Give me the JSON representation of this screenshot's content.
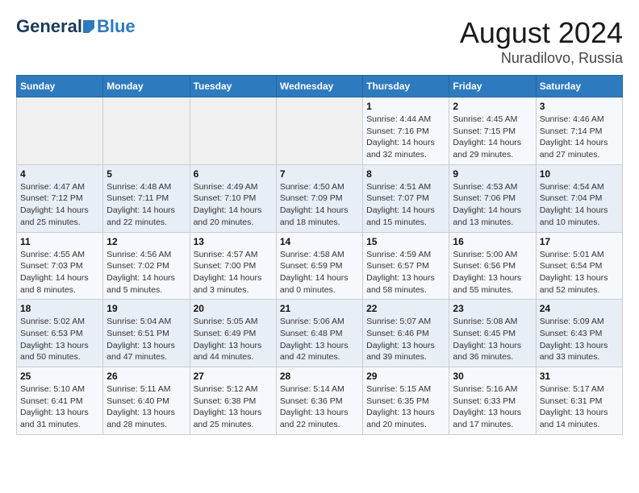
{
  "header": {
    "logo_general": "General",
    "logo_blue": "Blue",
    "month": "August 2024",
    "location": "Nuradilovo, Russia"
  },
  "weekdays": [
    "Sunday",
    "Monday",
    "Tuesday",
    "Wednesday",
    "Thursday",
    "Friday",
    "Saturday"
  ],
  "weeks": [
    [
      {
        "day": "",
        "info": ""
      },
      {
        "day": "",
        "info": ""
      },
      {
        "day": "",
        "info": ""
      },
      {
        "day": "",
        "info": ""
      },
      {
        "day": "1",
        "sunrise": "4:44 AM",
        "sunset": "7:16 PM",
        "daylight": "14 hours and 32 minutes."
      },
      {
        "day": "2",
        "sunrise": "4:45 AM",
        "sunset": "7:15 PM",
        "daylight": "14 hours and 29 minutes."
      },
      {
        "day": "3",
        "sunrise": "4:46 AM",
        "sunset": "7:14 PM",
        "daylight": "14 hours and 27 minutes."
      }
    ],
    [
      {
        "day": "4",
        "sunrise": "4:47 AM",
        "sunset": "7:12 PM",
        "daylight": "14 hours and 25 minutes."
      },
      {
        "day": "5",
        "sunrise": "4:48 AM",
        "sunset": "7:11 PM",
        "daylight": "14 hours and 22 minutes."
      },
      {
        "day": "6",
        "sunrise": "4:49 AM",
        "sunset": "7:10 PM",
        "daylight": "14 hours and 20 minutes."
      },
      {
        "day": "7",
        "sunrise": "4:50 AM",
        "sunset": "7:09 PM",
        "daylight": "14 hours and 18 minutes."
      },
      {
        "day": "8",
        "sunrise": "4:51 AM",
        "sunset": "7:07 PM",
        "daylight": "14 hours and 15 minutes."
      },
      {
        "day": "9",
        "sunrise": "4:53 AM",
        "sunset": "7:06 PM",
        "daylight": "14 hours and 13 minutes."
      },
      {
        "day": "10",
        "sunrise": "4:54 AM",
        "sunset": "7:04 PM",
        "daylight": "14 hours and 10 minutes."
      }
    ],
    [
      {
        "day": "11",
        "sunrise": "4:55 AM",
        "sunset": "7:03 PM",
        "daylight": "14 hours and 8 minutes."
      },
      {
        "day": "12",
        "sunrise": "4:56 AM",
        "sunset": "7:02 PM",
        "daylight": "14 hours and 5 minutes."
      },
      {
        "day": "13",
        "sunrise": "4:57 AM",
        "sunset": "7:00 PM",
        "daylight": "14 hours and 3 minutes."
      },
      {
        "day": "14",
        "sunrise": "4:58 AM",
        "sunset": "6:59 PM",
        "daylight": "14 hours and 0 minutes."
      },
      {
        "day": "15",
        "sunrise": "4:59 AM",
        "sunset": "6:57 PM",
        "daylight": "13 hours and 58 minutes."
      },
      {
        "day": "16",
        "sunrise": "5:00 AM",
        "sunset": "6:56 PM",
        "daylight": "13 hours and 55 minutes."
      },
      {
        "day": "17",
        "sunrise": "5:01 AM",
        "sunset": "6:54 PM",
        "daylight": "13 hours and 52 minutes."
      }
    ],
    [
      {
        "day": "18",
        "sunrise": "5:02 AM",
        "sunset": "6:53 PM",
        "daylight": "13 hours and 50 minutes."
      },
      {
        "day": "19",
        "sunrise": "5:04 AM",
        "sunset": "6:51 PM",
        "daylight": "13 hours and 47 minutes."
      },
      {
        "day": "20",
        "sunrise": "5:05 AM",
        "sunset": "6:49 PM",
        "daylight": "13 hours and 44 minutes."
      },
      {
        "day": "21",
        "sunrise": "5:06 AM",
        "sunset": "6:48 PM",
        "daylight": "13 hours and 42 minutes."
      },
      {
        "day": "22",
        "sunrise": "5:07 AM",
        "sunset": "6:46 PM",
        "daylight": "13 hours and 39 minutes."
      },
      {
        "day": "23",
        "sunrise": "5:08 AM",
        "sunset": "6:45 PM",
        "daylight": "13 hours and 36 minutes."
      },
      {
        "day": "24",
        "sunrise": "5:09 AM",
        "sunset": "6:43 PM",
        "daylight": "13 hours and 33 minutes."
      }
    ],
    [
      {
        "day": "25",
        "sunrise": "5:10 AM",
        "sunset": "6:41 PM",
        "daylight": "13 hours and 31 minutes."
      },
      {
        "day": "26",
        "sunrise": "5:11 AM",
        "sunset": "6:40 PM",
        "daylight": "13 hours and 28 minutes."
      },
      {
        "day": "27",
        "sunrise": "5:12 AM",
        "sunset": "6:38 PM",
        "daylight": "13 hours and 25 minutes."
      },
      {
        "day": "28",
        "sunrise": "5:14 AM",
        "sunset": "6:36 PM",
        "daylight": "13 hours and 22 minutes."
      },
      {
        "day": "29",
        "sunrise": "5:15 AM",
        "sunset": "6:35 PM",
        "daylight": "13 hours and 20 minutes."
      },
      {
        "day": "30",
        "sunrise": "5:16 AM",
        "sunset": "6:33 PM",
        "daylight": "13 hours and 17 minutes."
      },
      {
        "day": "31",
        "sunrise": "5:17 AM",
        "sunset": "6:31 PM",
        "daylight": "13 hours and 14 minutes."
      }
    ]
  ],
  "labels": {
    "sunrise": "Sunrise:",
    "sunset": "Sunset:",
    "daylight": "Daylight hours"
  }
}
